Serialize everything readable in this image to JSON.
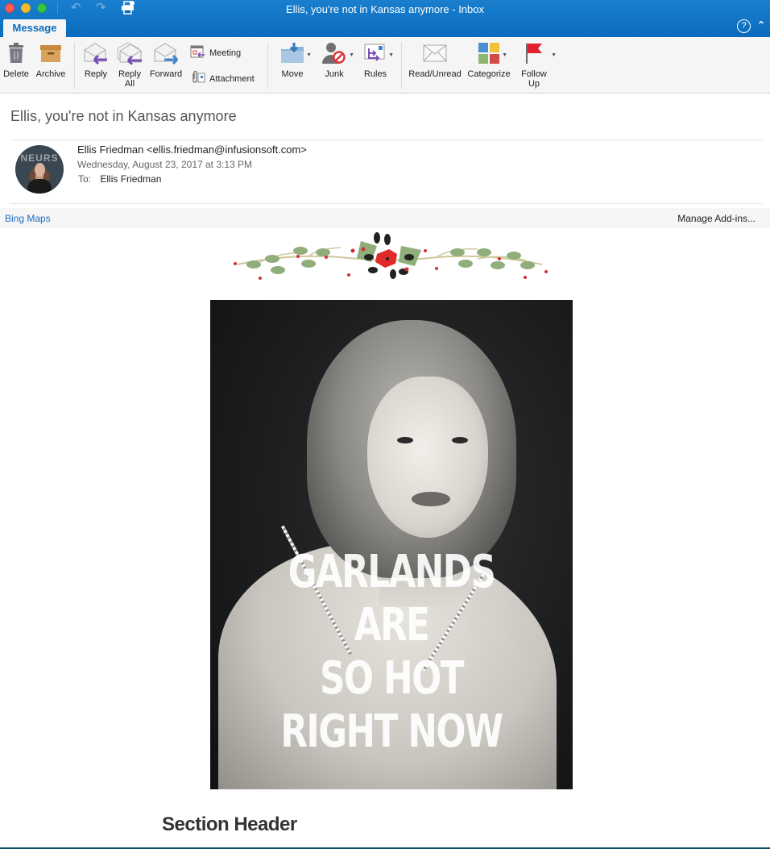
{
  "window": {
    "title": "Ellis, you're not in Kansas anymore - Inbox",
    "traffic_lights": [
      "close",
      "minimize",
      "zoom"
    ],
    "quick_access": [
      "undo-icon",
      "redo-icon",
      "print-icon"
    ],
    "active_tab": "Message",
    "accent_color": "#0a6bbd"
  },
  "ribbon": {
    "buttons": [
      {
        "id": "delete",
        "label": "Delete",
        "icon": "trash-icon"
      },
      {
        "id": "archive",
        "label": "Archive",
        "icon": "archive-box-icon"
      },
      {
        "id": "reply",
        "label": "Reply",
        "icon": "reply-icon"
      },
      {
        "id": "reply_all",
        "label": "Reply\nAll",
        "icon": "reply-all-icon"
      },
      {
        "id": "forward",
        "label": "Forward",
        "icon": "forward-icon"
      },
      {
        "id": "meeting",
        "label": "Meeting",
        "icon": "calendar-icon"
      },
      {
        "id": "attachment",
        "label": "Attachment",
        "icon": "paperclip-icon"
      },
      {
        "id": "move",
        "label": "Move",
        "icon": "folder-move-icon"
      },
      {
        "id": "junk",
        "label": "Junk",
        "icon": "junk-user-icon"
      },
      {
        "id": "rules",
        "label": "Rules",
        "icon": "rules-icon"
      },
      {
        "id": "read_unread",
        "label": "Read/Unread",
        "icon": "envelope-icon"
      },
      {
        "id": "categorize",
        "label": "Categorize",
        "icon": "categories-grid-icon"
      },
      {
        "id": "follow_up",
        "label": "Follow\nUp",
        "icon": "flag-icon"
      }
    ]
  },
  "message": {
    "subject": "Ellis, you're not in Kansas anymore",
    "sender": "Ellis Friedman <ellis.friedman@infusionsoft.com>",
    "datetime": "Wednesday, August 23, 2017 at 3:13 PM",
    "to_label": "To:",
    "to": "Ellis Friedman",
    "avatar_text": "NEURS"
  },
  "addins": {
    "left_link": "Bing Maps",
    "right_link": "Manage Add-ins..."
  },
  "body": {
    "hero_text_lines": [
      "GARLANDS ARE",
      "SO HOT",
      "RIGHT NOW"
    ],
    "section_header": "Section Header"
  }
}
